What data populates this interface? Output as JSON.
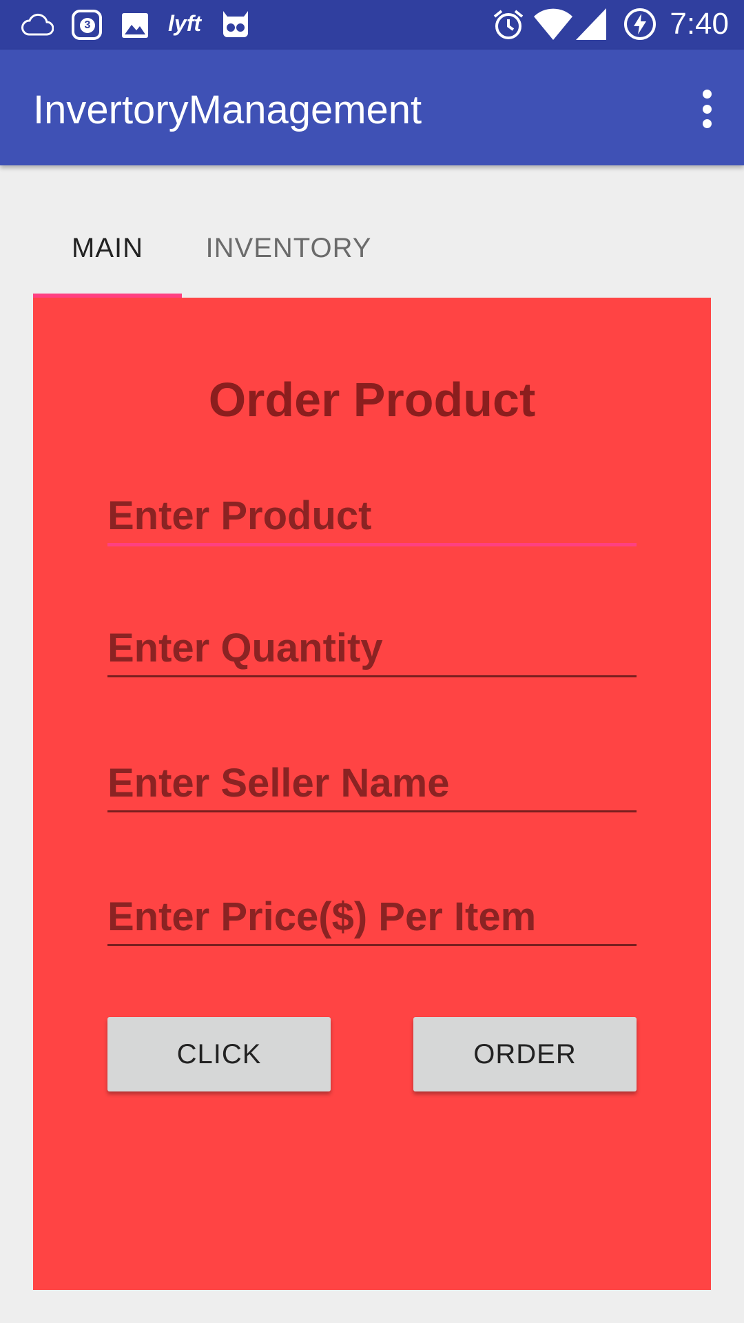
{
  "status_bar": {
    "time": "7:40",
    "notification_count": "3",
    "icons": [
      "cloud-icon",
      "instagram-notification-icon",
      "image-icon",
      "lyft-icon",
      "cyanogen-icon",
      "alarm-icon",
      "wifi-icon",
      "signal-icon",
      "battery-charging-icon"
    ]
  },
  "app_bar": {
    "title": "InvertoryManagement",
    "overflow_icon": "more-vert-icon"
  },
  "tabs": [
    {
      "label": "MAIN",
      "selected": true
    },
    {
      "label": "INVENTORY",
      "selected": false
    }
  ],
  "form": {
    "title": "Order Product",
    "product_placeholder": "Enter Product",
    "quantity_placeholder": "Enter Quantity",
    "seller_placeholder": "Enter Seller Name",
    "price_placeholder": "Enter Price($) Per Item",
    "click_button": "CLICK",
    "order_button": "ORDER"
  },
  "colors": {
    "status_bar": "#303f9f",
    "app_bar": "#3f51b5",
    "accent": "#ff4081",
    "panel": "#ff4444",
    "text_dark_red": "#8b2323",
    "button": "#d6d7d7"
  }
}
